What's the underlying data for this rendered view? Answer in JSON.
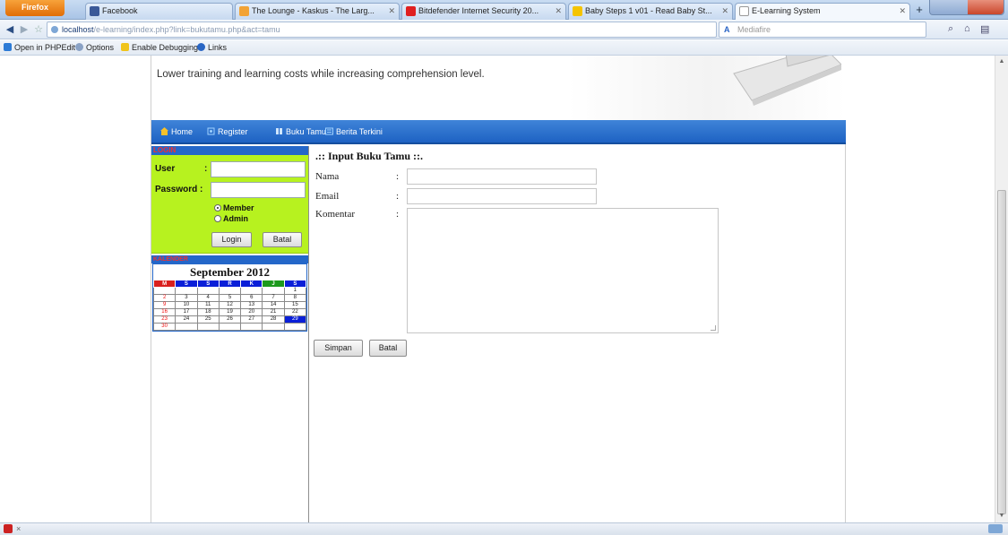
{
  "browser": {
    "firefox_label": "Firefox",
    "tabs": [
      {
        "title": "Facebook",
        "color": "#3b5998"
      },
      {
        "title": "The Lounge - Kaskus - The Larg...",
        "color": "#f2a336"
      },
      {
        "title": "Bitdefender Internet Security 20...",
        "color": "#e02020"
      },
      {
        "title": "Baby Steps 1 v01 - Read Baby St...",
        "color": "#f5c400"
      },
      {
        "title": "E-Learning System",
        "color": "#ffffff"
      }
    ],
    "url": {
      "host": "localhost",
      "path": "/e-learning/index.php?link=bukutamu.php&act=tamu"
    },
    "search_placeholder": "Mediafire",
    "bookmarks": [
      {
        "label": "Open in PHPEdit",
        "color": "#2d7bd6"
      },
      {
        "label": "Options",
        "color": "#8aa2c5"
      },
      {
        "label": "Enable Debugging",
        "color": "#f0c41b"
      },
      {
        "label": "Links",
        "color": "#2a66c4"
      }
    ]
  },
  "header": {
    "tagline": "Lower training and learning costs while increasing comprehension level."
  },
  "menu": [
    {
      "label": "Home",
      "color": "#f7c12a"
    },
    {
      "label": "Register",
      "color": "#9fd1ff"
    },
    {
      "label": "Buku Tamu",
      "color": "#cfe6ff"
    },
    {
      "label": "Berita Terkini",
      "color": "#9fd1ff"
    }
  ],
  "login": {
    "title": "LOGIN",
    "user_label": "User",
    "password_label": "Password :",
    "colon": ":",
    "options": [
      {
        "label": "Member",
        "selected": true
      },
      {
        "label": "Admin",
        "selected": false
      }
    ],
    "login_button": "Login",
    "cancel_button": "Batal"
  },
  "calendar": {
    "title": "KALENDER",
    "month": "September 2012",
    "weekdays": [
      "M",
      "S",
      "S",
      "R",
      "K",
      "J",
      "S"
    ],
    "weeks": [
      [
        "",
        "",
        "",
        "",
        "",
        "",
        "1"
      ],
      [
        "2",
        "3",
        "4",
        "5",
        "6",
        "7",
        "8"
      ],
      [
        "9",
        "10",
        "11",
        "12",
        "13",
        "14",
        "15"
      ],
      [
        "16",
        "17",
        "18",
        "19",
        "20",
        "21",
        "22"
      ],
      [
        "23",
        "24",
        "25",
        "26",
        "27",
        "28",
        "29"
      ],
      [
        "30",
        "",
        "",
        "",
        "",
        "",
        ""
      ]
    ],
    "today": "29"
  },
  "guestbook": {
    "title": ".:: Input Buku Tamu ::.",
    "fields": [
      {
        "label": "Nama",
        "colon": ":"
      },
      {
        "label": "Email",
        "colon": ":"
      },
      {
        "label": "Komentar",
        "colon": ":"
      }
    ],
    "submit_button": "Simpan",
    "cancel_button": "Batal"
  }
}
